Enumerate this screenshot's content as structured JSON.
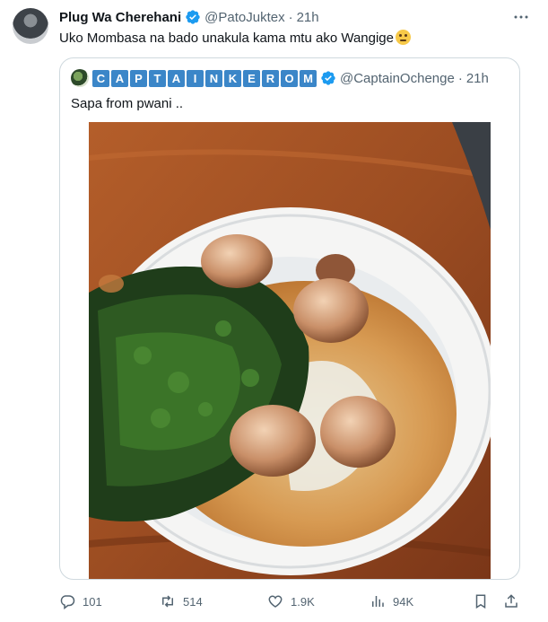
{
  "tweet": {
    "author_name": "Plug Wa Cherehani",
    "author_handle": "@PatoJuktex",
    "separator": "·",
    "time": "21h",
    "text": "Uko Mombasa na bado unakula kama mtu ako Wangige",
    "emoji": "thinking-face-emoji"
  },
  "quoted_tweet": {
    "author_name_letters": [
      "C",
      "A",
      "P",
      "T",
      "A",
      "I",
      "N",
      "K",
      "E",
      "R",
      "O",
      "M"
    ],
    "author_handle": "@CaptainOchenge",
    "separator": "·",
    "time": "21h",
    "text": "Sapa from pwani .."
  },
  "actions": {
    "reply_count": "101",
    "retweet_count": "514",
    "like_count": "1.9K",
    "view_count": "94K"
  },
  "icons": {
    "reply": "reply-icon",
    "retweet": "retweet-icon",
    "like": "heart-icon",
    "views": "views-icon",
    "bookmark": "bookmark-icon",
    "share": "share-icon",
    "more": "more-icon",
    "verified": "verified-icon"
  },
  "colors": {
    "verified": "#1d9bf0",
    "secondary_text": "#536471",
    "name_tiles": "#3b86c8"
  }
}
